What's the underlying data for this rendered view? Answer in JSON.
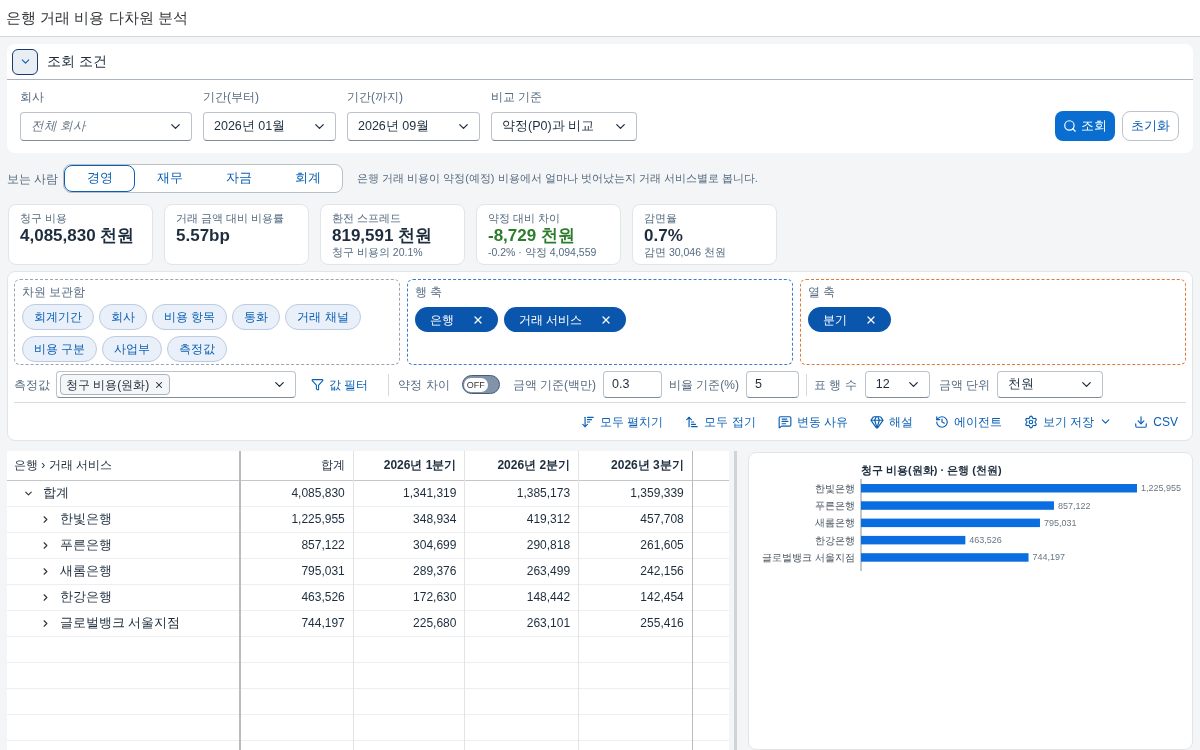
{
  "window": {
    "title": "은행 거래 비용 다차원 분석"
  },
  "query_panel": {
    "expanded": true,
    "title": "조회 조건",
    "fields": [
      {
        "label": "회사",
        "placeholder": "전체 회사"
      },
      {
        "label": "기간(부터)",
        "value": "2026년 01월"
      },
      {
        "label": "기간(까지)",
        "value": "2026년 09월"
      },
      {
        "label": "비교 기준",
        "value": "약정(P0)과 비교"
      }
    ],
    "buttons": [
      {
        "label": "조회",
        "kind": "primary"
      },
      {
        "label": "초기화",
        "kind": "secondary"
      }
    ]
  },
  "viewer": {
    "label": "보는 사람",
    "tabs": [
      {
        "label": "경영",
        "selected": true
      },
      {
        "label": "재무",
        "selected": false
      },
      {
        "label": "자금",
        "selected": false
      },
      {
        "label": "회계",
        "selected": false
      }
    ],
    "description": "은행 거래 비용이 약정(예정) 비용에서 얼마나 벗어났는지 거래 서비스별로 봅니다."
  },
  "kpis": [
    {
      "label": "청구 비용",
      "value": "4,085,830 천원"
    },
    {
      "label": "거래 금액 대비 비용률",
      "value": "5.57bp"
    },
    {
      "label": "환전 스프레드",
      "value": "819,591 천원",
      "sub": "청구 비용의 20.1%"
    },
    {
      "label": "약정 대비 차이",
      "value": "-8,729 천원",
      "sub": "-0.2% · 약정 4,094,559",
      "color": "#2b7d2b"
    },
    {
      "label": "감면율",
      "value": "0.7%",
      "sub": "감면 30,046 천원"
    }
  ],
  "dimension_pool": {
    "title": "차원 보관함",
    "chips": [
      "회계기간",
      "회사",
      "비용 항목",
      "통화",
      "거래 채널",
      "비용 구분",
      "사업부",
      "측정값"
    ]
  },
  "row_axis": {
    "title": "행 축",
    "chips": [
      "은행",
      "거래 서비스"
    ]
  },
  "column_axis": {
    "title": "열 축",
    "chips": [
      "분기"
    ]
  },
  "filters": {
    "measure": {
      "label": "측정값",
      "chips": [
        "청구 비용(원화)"
      ]
    },
    "value_filter": "값 필터",
    "contract_diff": {
      "label": "약정 차이",
      "switch_text": "OFF",
      "on": false
    },
    "amount_threshold": {
      "label": "금액 기준(백만)",
      "value": "0.3"
    },
    "ratio_threshold": {
      "label": "비율 기준(%)",
      "value": "5"
    },
    "page_rows": {
      "label": "표 행 수",
      "value": "12"
    },
    "amount_unit": {
      "label": "금액 단위",
      "value": "천원"
    }
  },
  "toolbar": [
    {
      "label": "모두 펼치기",
      "kind": "expand",
      "dropdown": false
    },
    {
      "label": "모두 접기",
      "kind": "collapse",
      "dropdown": false
    },
    {
      "label": "변동 사유",
      "kind": "comment",
      "dropdown": false
    },
    {
      "label": "해설",
      "kind": "insight",
      "dropdown": false
    },
    {
      "label": "에이전트",
      "kind": "agent",
      "dropdown": false
    },
    {
      "label": "보기 저장",
      "kind": "save",
      "dropdown": true
    },
    {
      "label": "CSV",
      "kind": "download",
      "dropdown": false
    }
  ],
  "table": {
    "columns": [
      {
        "label": "은행 › 거래 서비스",
        "kind": "dimension"
      },
      {
        "label": "합계",
        "kind": "total"
      },
      {
        "label": "2026년 1분기",
        "kind": "period"
      },
      {
        "label": "2026년 2분기",
        "kind": "period"
      },
      {
        "label": "2026년 3분기",
        "kind": "period"
      }
    ],
    "rows": [
      {
        "label": "합계",
        "expanded": true,
        "values": [
          "4,085,830",
          "1,341,319",
          "1,385,173",
          "1,359,339"
        ],
        "children": [
          {
            "label": "한빛은행",
            "expanded": false,
            "values": [
              "1,225,955",
              "348,934",
              "419,312",
              "457,708"
            ]
          },
          {
            "label": "푸른은행",
            "expanded": false,
            "values": [
              "857,122",
              "304,699",
              "290,818",
              "261,605"
            ]
          },
          {
            "label": "새롬은행",
            "expanded": false,
            "values": [
              "795,031",
              "289,376",
              "263,499",
              "242,156"
            ]
          },
          {
            "label": "한강은행",
            "expanded": false,
            "values": [
              "463,526",
              "172,630",
              "148,442",
              "142,454"
            ]
          },
          {
            "label": "글로벌뱅크 서울지점",
            "expanded": false,
            "values": [
              "744,197",
              "225,680",
              "263,101",
              "255,416"
            ]
          }
        ]
      }
    ]
  },
  "chart": {
    "chart_data": {
      "type": "bar",
      "orientation": "horizontal",
      "title": "청구 비용(원화) · 은행 (천원)",
      "categories": [
        "한빛은행",
        "푸른은행",
        "새롬은행",
        "한강은행",
        "글로벌뱅크 서울지점"
      ],
      "values": [
        1225955,
        857122,
        795031,
        463526,
        744197
      ],
      "value_labels": [
        "1,225,955",
        "857,122",
        "795,031",
        "463,526",
        "744,197"
      ]
    }
  }
}
